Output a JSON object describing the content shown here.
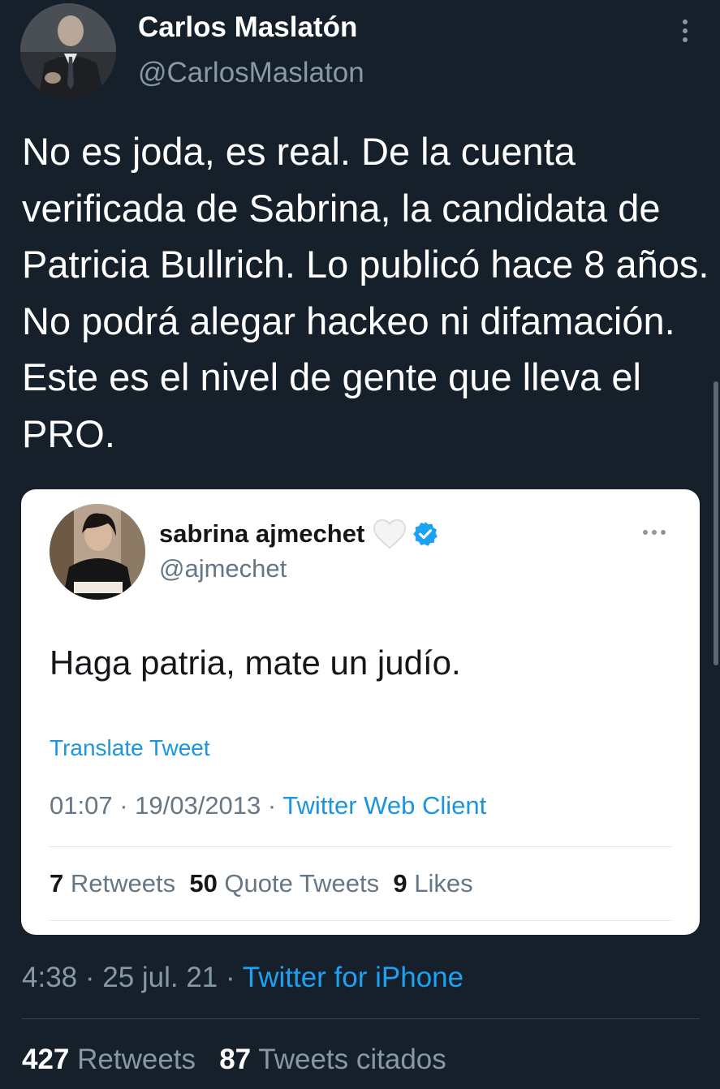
{
  "author": {
    "display_name": "Carlos Maslatón",
    "handle": "@CarlosMaslaton"
  },
  "tweet": {
    "text": "No es joda, es real. De la cuenta verificada de Sabrina, la candidata de Patricia Bullrich. Lo publicó hace 8 años. No podrá alegar hackeo ni difamación. Este es el nivel de gente que lleva el PRO.",
    "time": "4:38 · 25 jul. 21 · ",
    "client": "Twitter for iPhone",
    "retweets_count": "427",
    "retweets_label": " Retweets",
    "quotes_count": "87",
    "quotes_label": " Tweets citados"
  },
  "quoted_tweet": {
    "display_name": "sabrina ajmechet",
    "handle": "@ajmechet",
    "text": "Haga patria, mate un judío.",
    "translate_label": "Translate Tweet",
    "time": "01:07 · 19/03/2013 · ",
    "client": "Twitter Web Client",
    "retweets_count": "7",
    "retweets_label": " Retweets",
    "quotes_count": "50",
    "quotes_label": " Quote Tweets",
    "likes_count": "9",
    "likes_label": " Likes"
  },
  "colors": {
    "background": "#15202b",
    "link_dark": "#1da1f2",
    "link_light": "#1b95e0",
    "verified": "#1da1f2"
  },
  "icons": {
    "menu": "more-vertical-icon",
    "card_menu": "more-horizontal-icon",
    "heart": "white-heart-icon",
    "verified": "verified-badge-icon"
  }
}
